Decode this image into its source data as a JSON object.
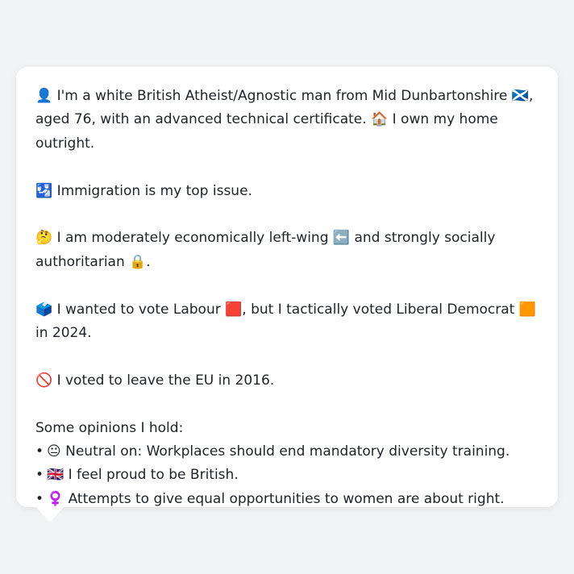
{
  "card": {
    "p1": "👤 I'm a white British Atheist/Agnostic man from Mid Dunbartonshire 🏴󠁧󠁢󠁳󠁣󠁴󠁿, aged 76, with an advanced technical certificate. 🏠 I own my home outright.",
    "p2": "🛂 Immigration is my top issue.",
    "p3": "🤔 I am moderately economically left-wing ⬅️ and strongly socially authoritarian 🔒.",
    "p4": "🗳️ I wanted to vote Labour 🟥, but I tactically voted Liberal Democrat 🟧 in 2024.",
    "p5": "🚫 I voted to leave the EU in 2016.",
    "opinions_heading": "Some opinions I hold:",
    "opinions": [
      "😐 Neutral on: Workplaces should end mandatory diversity training.",
      "🇬🇧 I feel proud to be British.",
      "♀️ Attempts to give equal opportunities to women are about right."
    ],
    "bullet": "•"
  },
  "colors": {
    "background": "#f2f3f5",
    "card": "#ffffff",
    "text": "#1f2328"
  }
}
